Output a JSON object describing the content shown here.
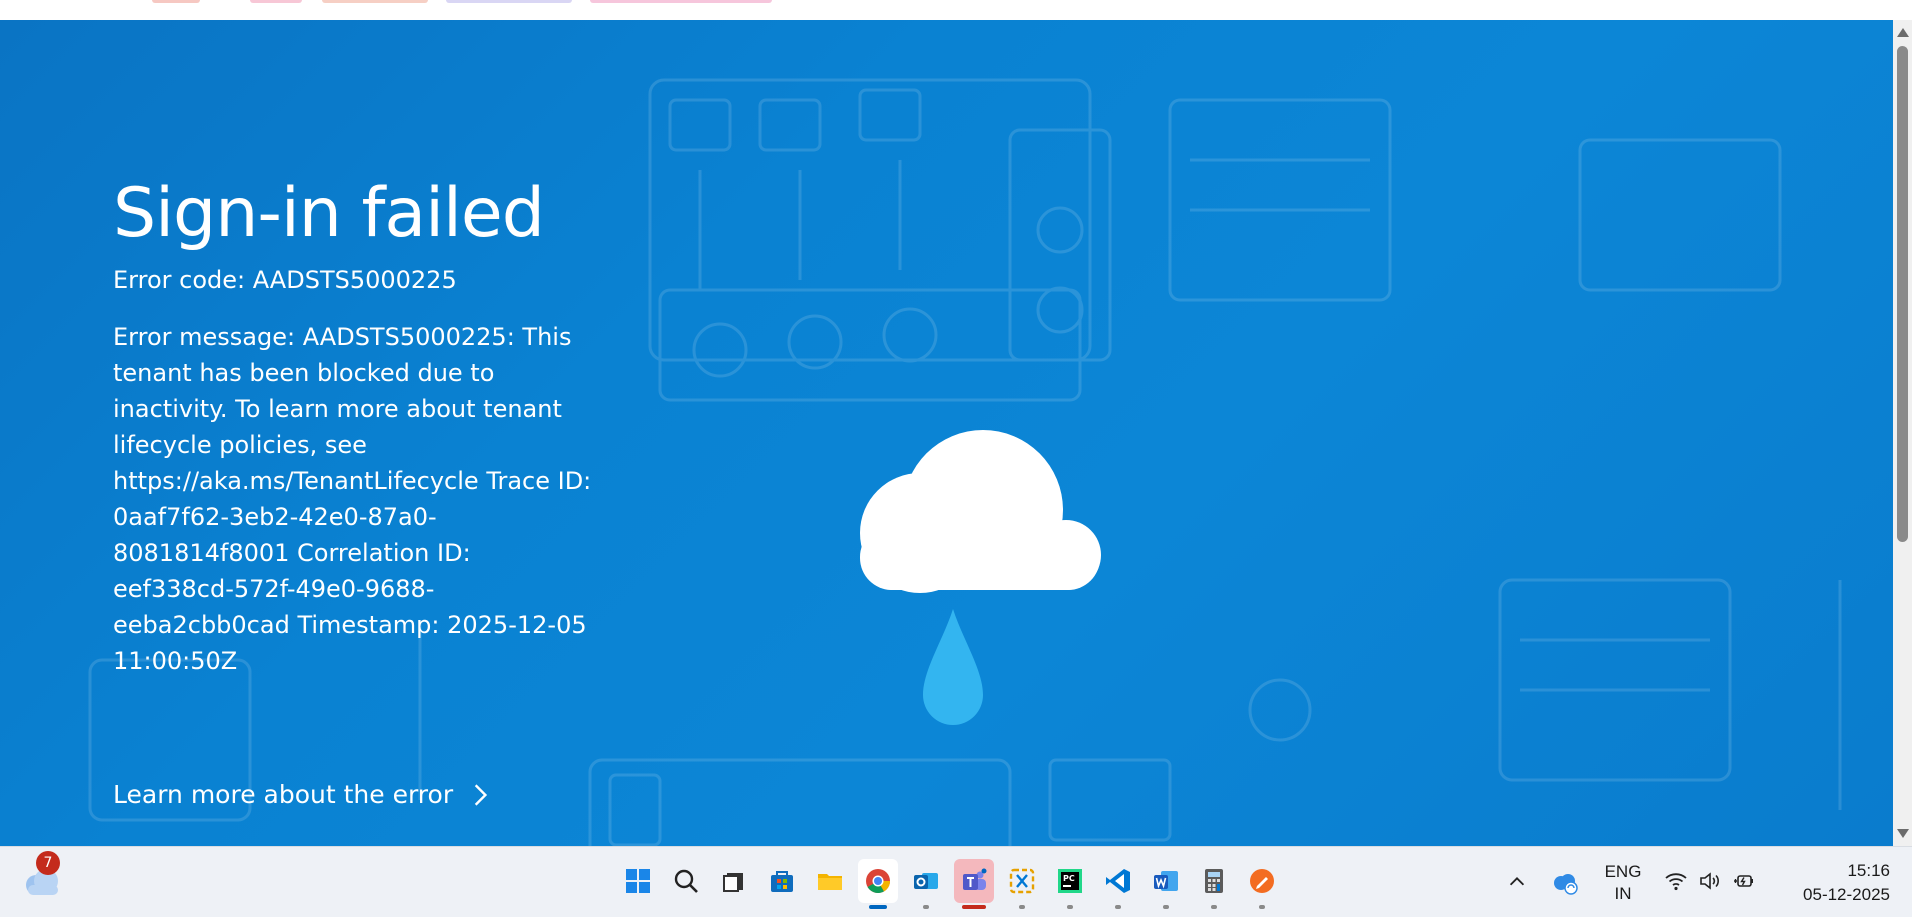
{
  "page": {
    "title": "Sign-in failed",
    "error_code": "Error code: AADSTS5000225",
    "error_message": "Error message: AADSTS5000225: This tenant has been blocked due to inactivity. To learn more about tenant lifecycle policies, see https://aka.ms/TenantLifecycle Trace ID: 0aaf7f62-3eb2-42e0-87a0-8081814f8001 Correlation ID: eef338cd-572f-49e0-9688-eeba2cbb0cad Timestamp: 2025-12-05 11:00:50Z",
    "learn_more_label": "Learn more about the error"
  },
  "colors": {
    "page_background": "#0a7ccd",
    "text": "#ffffff",
    "raindrop": "#33b5f0",
    "taskbar": "#eef1f6",
    "notification_badge": "#c42b1c"
  },
  "taskbar": {
    "weather_badge": "7",
    "apps": [
      {
        "name": "start-icon",
        "running": false
      },
      {
        "name": "search-icon",
        "running": false
      },
      {
        "name": "task-view-icon",
        "running": false
      },
      {
        "name": "microsoft-store-icon",
        "running": false
      },
      {
        "name": "file-explorer-icon",
        "running": false
      },
      {
        "name": "chrome-icon",
        "running": true,
        "active": true
      },
      {
        "name": "outlook-icon",
        "running": true
      },
      {
        "name": "teams-icon",
        "running": true,
        "active": true
      },
      {
        "name": "snipping-tool-icon",
        "running": true
      },
      {
        "name": "pycharm-icon",
        "running": true
      },
      {
        "name": "vscode-icon",
        "running": true
      },
      {
        "name": "word-icon",
        "running": true
      },
      {
        "name": "calculator-icon",
        "running": true
      },
      {
        "name": "pen-app-icon",
        "running": true
      }
    ],
    "language_line1": "ENG",
    "language_line2": "IN",
    "time": "15:16",
    "date": "05-12-2025"
  }
}
